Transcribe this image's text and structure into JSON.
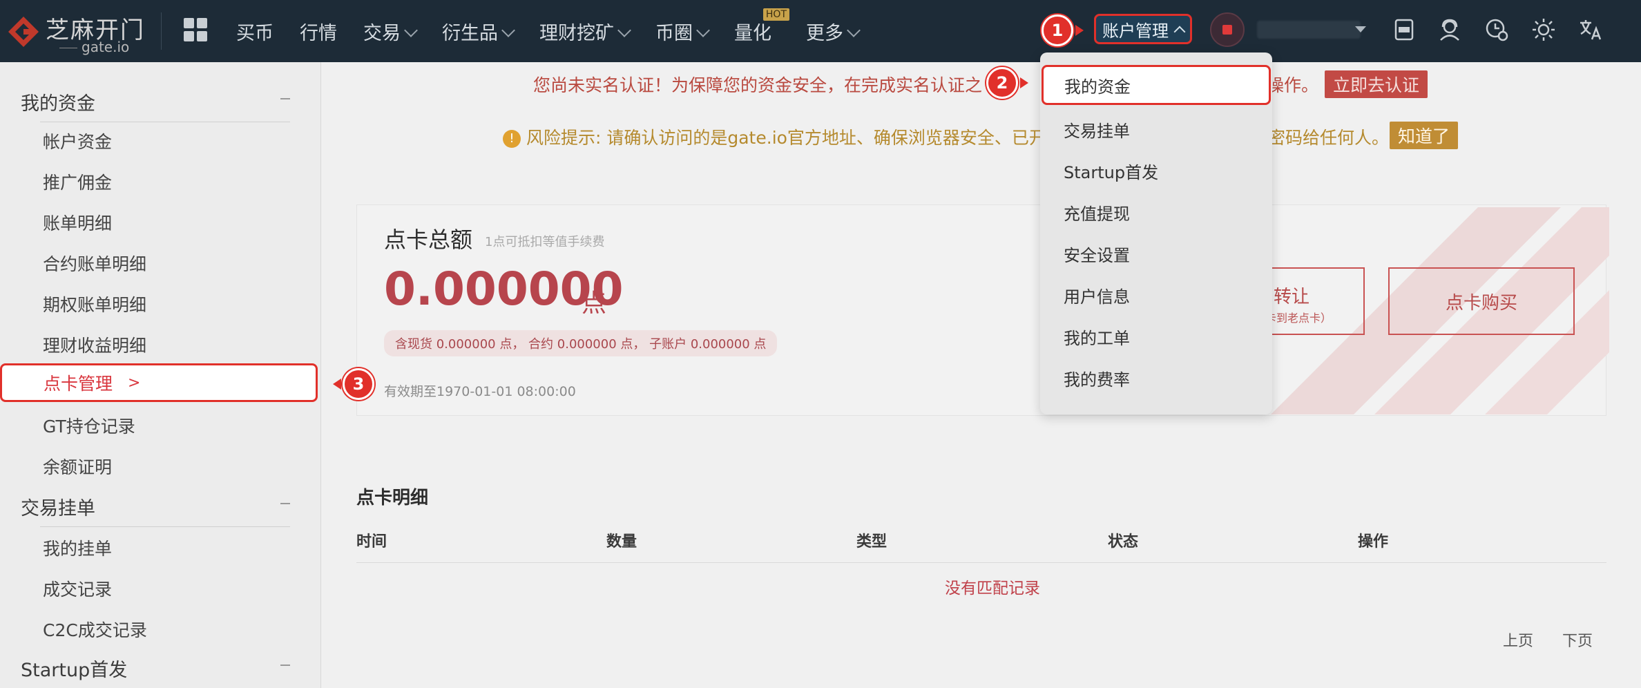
{
  "header": {
    "logo_cn": "芝麻开门",
    "logo_en": "gate.io",
    "nav": [
      {
        "label": "买币",
        "dropdown": false
      },
      {
        "label": "行情",
        "dropdown": false
      },
      {
        "label": "交易",
        "dropdown": true
      },
      {
        "label": "衍生品",
        "dropdown": true
      },
      {
        "label": "理财挖矿",
        "dropdown": true
      },
      {
        "label": "币圈",
        "dropdown": true
      },
      {
        "label": "量化",
        "dropdown": false,
        "badge": "HOT"
      },
      {
        "label": "更多",
        "dropdown": true
      }
    ],
    "account_menu_label": "账户管理",
    "icons": [
      "app-download-icon",
      "support-icon",
      "settings-clock-icon",
      "theme-sun-icon",
      "language-icon"
    ]
  },
  "sidebar": {
    "groups": [
      {
        "label": "我的资金",
        "items": [
          "帐户资金",
          "推广佣金",
          "账单明细",
          "合约账单明细",
          "期权账单明细",
          "理财收益明细",
          "点卡管理",
          "GT持仓记录",
          "余额证明"
        ]
      },
      {
        "label": "交易挂单",
        "items": [
          "我的挂单",
          "成交记录",
          "C2C成交记录"
        ]
      },
      {
        "label": "Startup首发",
        "items": []
      }
    ],
    "active_item": "点卡管理",
    "active_suffix": ">"
  },
  "notices": {
    "kyc_text": "您尚未实名认证！为保障您的资金安全，在完成实名认证之",
    "kyc_tail": "操作。",
    "kyc_button": "立即去认证",
    "risk_text": "风险提示: 请确认访问的是gate.io官方地址、确保浏览器安全、已开",
    "risk_tail": "密码给任何人。",
    "risk_button": "知道了"
  },
  "points_card": {
    "title": "点卡总额",
    "subtitle": "1点可抵扣等值手续费",
    "amount": "0.000000",
    "unit": "点",
    "breakdown": "含现货 0.000000 点， 合约 0.000000 点， 子账户 0.000000 点",
    "expiry": "有效期至1970-01-01 08:00:00",
    "transfer_label": "转让",
    "transfer_sub": "卡到老点卡）",
    "buy_label": "点卡购买"
  },
  "details": {
    "title": "点卡明细",
    "columns": [
      "时间",
      "数量",
      "类型",
      "状态",
      "操作"
    ],
    "empty_text": "没有匹配记录",
    "prev": "上页",
    "next": "下页"
  },
  "account_dropdown": {
    "items": [
      "我的资金",
      "交易挂单",
      "Startup首发",
      "充值提现",
      "安全设置",
      "用户信息",
      "我的工单",
      "我的费率"
    ],
    "highlighted": "我的资金"
  },
  "markers": [
    "1",
    "2",
    "3"
  ],
  "colors": {
    "topbar": "#1d2b37",
    "accent_red": "#e1302a",
    "amount_red": "#b7454d"
  }
}
